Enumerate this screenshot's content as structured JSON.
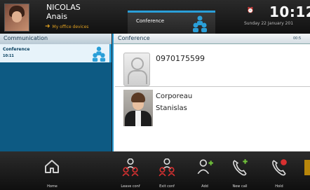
{
  "user": {
    "first_name": "NICOLAS",
    "last_name": "Anais",
    "status": "My office devices"
  },
  "top_tab": {
    "label": "Conference"
  },
  "clock": {
    "time": "10:12",
    "date": "Sunday 22 January 201"
  },
  "left_panel": {
    "header": "Communication",
    "items": [
      {
        "title": "Conference",
        "time": "10:11"
      }
    ]
  },
  "right_panel": {
    "header": "Conference",
    "header_time": "00:5",
    "participants": [
      {
        "number": "0970175599"
      },
      {
        "first_line": "Corporeau",
        "second_line": "Stanislas"
      }
    ]
  },
  "bottom_bar": {
    "home": {
      "label": "Home",
      "icon": "home-icon"
    },
    "actions": [
      {
        "label": "Leave conf",
        "icon": "leave-conference-icon"
      },
      {
        "label": "Exit conf",
        "icon": "exit-conference-icon"
      },
      {
        "label": "Add",
        "icon": "add-participant-icon"
      },
      {
        "label": "New call",
        "icon": "new-call-icon"
      },
      {
        "label": "Hold",
        "icon": "hold-call-icon"
      }
    ]
  },
  "colors": {
    "accent": "#2a9fd8",
    "left_panel_bg": "#0d5a83",
    "selected_item_bg": "#e7f3fa",
    "icon_red": "#d83030",
    "icon_green": "#6fbf3a"
  }
}
